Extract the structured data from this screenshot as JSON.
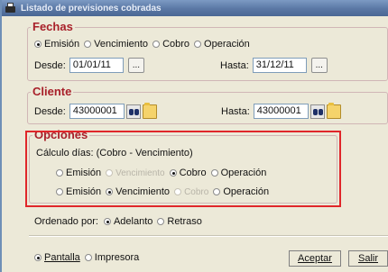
{
  "window": {
    "title": "Listado de previsiones cobradas"
  },
  "fechas": {
    "legend": "Fechas",
    "options": [
      {
        "label": "Emisión",
        "selected": true
      },
      {
        "label": "Vencimiento",
        "selected": false
      },
      {
        "label": "Cobro",
        "selected": false
      },
      {
        "label": "Operación",
        "selected": false
      }
    ],
    "desde_label": "Desde:",
    "desde_value": "01/01/11",
    "hasta_label": "Hasta:",
    "hasta_value": "31/12/11",
    "button_label": "..."
  },
  "cliente": {
    "legend": "Cliente",
    "desde_label": "Desde:",
    "desde_value": "43000001",
    "hasta_label": "Hasta:",
    "hasta_value": "43000001"
  },
  "opciones": {
    "legend": "Opciones",
    "calc_label": "Cálculo días: (Cobro - Vencimiento)",
    "row1": [
      {
        "label": "Emisión",
        "selected": false,
        "disabled": false
      },
      {
        "label": "Vencimiento",
        "selected": false,
        "disabled": true
      },
      {
        "label": "Cobro",
        "selected": true,
        "disabled": false
      },
      {
        "label": "Operación",
        "selected": false,
        "disabled": false
      }
    ],
    "row2": [
      {
        "label": "Emisión",
        "selected": false,
        "disabled": false
      },
      {
        "label": "Vencimiento",
        "selected": true,
        "disabled": false
      },
      {
        "label": "Cobro",
        "selected": false,
        "disabled": true
      },
      {
        "label": "Operación",
        "selected": false,
        "disabled": false
      }
    ]
  },
  "orden": {
    "label": "Ordenado por:",
    "options": [
      {
        "label": "Adelanto",
        "selected": true
      },
      {
        "label": "Retraso",
        "selected": false
      }
    ]
  },
  "salida": {
    "options": [
      {
        "label": "Pantalla",
        "selected": true
      },
      {
        "label": "Impresora",
        "selected": false
      }
    ]
  },
  "buttons": {
    "aceptar": "Aceptar",
    "salir": "Salir"
  },
  "colors": {
    "legend": "#a8202a",
    "highlight": "#e0262a",
    "titlebar": "#5a77a4"
  }
}
